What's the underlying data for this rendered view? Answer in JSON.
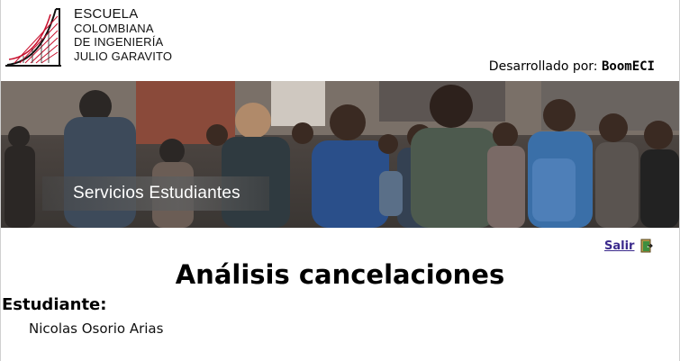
{
  "header": {
    "logo_lines": [
      "Escuela",
      "Colombiana",
      "de Ingeniería",
      "Julio Garavito"
    ],
    "developed_by_label": "Desarrollado por:",
    "developer_brand": "BoomECI"
  },
  "banner": {
    "title": "Servicios Estudiantes"
  },
  "logout": {
    "label": "Salir",
    "icon": "exit-door-icon"
  },
  "main": {
    "title": "Análisis cancelaciones",
    "student_label": "Estudiante:",
    "student_name": "Nicolas Osorio Arias"
  },
  "colors": {
    "link": "#3b2a8c",
    "logo_red": "#c8102e",
    "banner_label_bg": "#5a5a5a"
  }
}
